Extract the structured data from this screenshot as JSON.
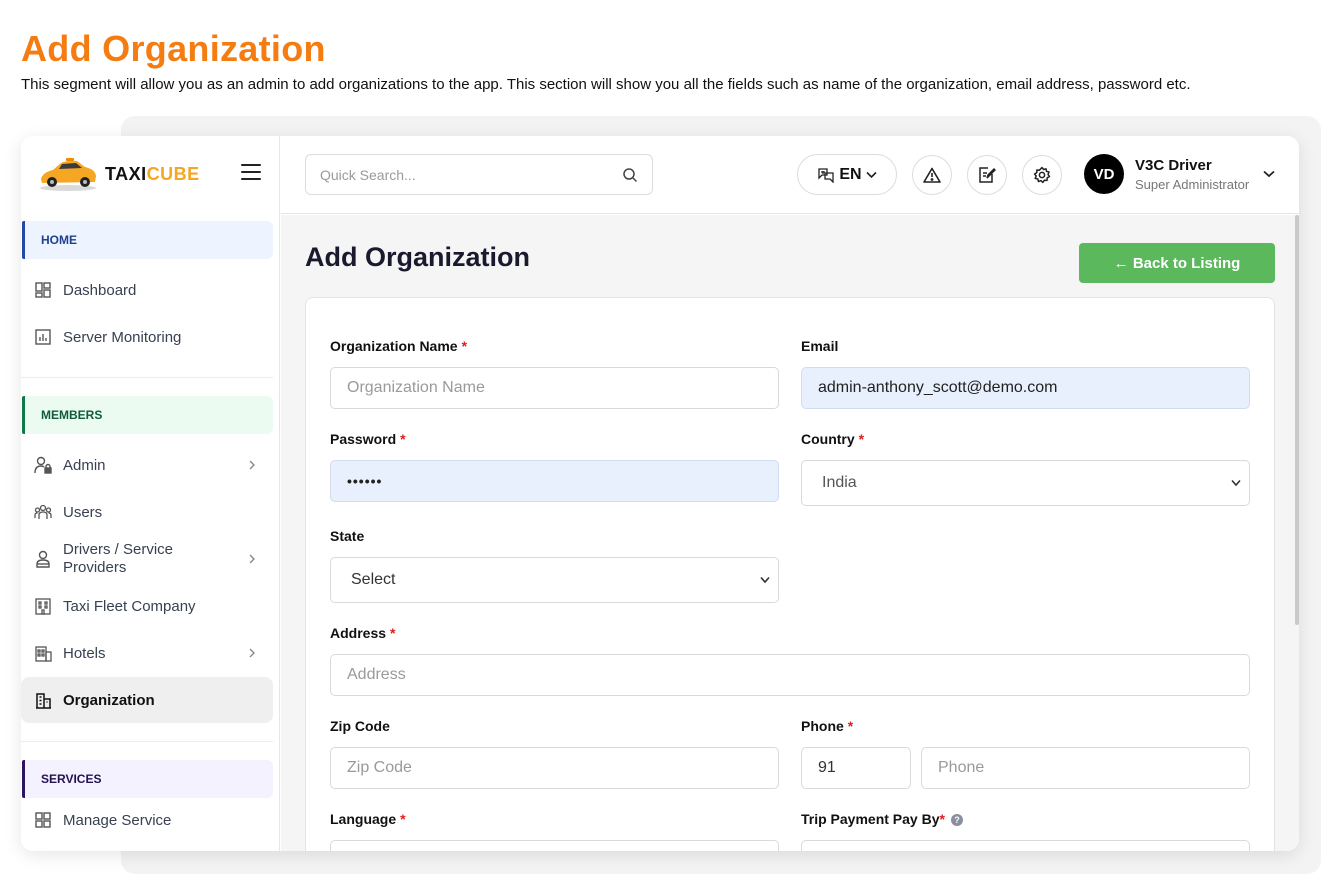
{
  "hero": {
    "title": "Add Organization",
    "description": "This segment will allow you as an admin to add organizations to the app. This section will show you all the fields such as name of the organization, email address, password etc."
  },
  "brand": {
    "name_a": "TAXI",
    "name_b": "CUBE",
    "accent": "#f5a623"
  },
  "sidebar": {
    "sections": {
      "home": "HOME",
      "members": "MEMBERS",
      "services": "SERVICES"
    },
    "items": [
      {
        "label": "Dashboard",
        "icon": "dashboard-icon"
      },
      {
        "label": "Server Monitoring",
        "icon": "monitor-chart-icon"
      },
      {
        "label": "Admin",
        "icon": "user-lock-icon",
        "has_submenu": true
      },
      {
        "label": "Users",
        "icon": "users-group-icon"
      },
      {
        "label": "Drivers / Service Providers",
        "icon": "driver-icon",
        "has_submenu": true
      },
      {
        "label": "Taxi Fleet Company",
        "icon": "building-icon"
      },
      {
        "label": "Hotels",
        "icon": "hotel-icon",
        "has_submenu": true
      },
      {
        "label": "Organization",
        "icon": "organization-icon",
        "active": true
      },
      {
        "label": "Manage Service",
        "icon": "grid-icon"
      }
    ]
  },
  "topbar": {
    "search_placeholder": "Quick Search...",
    "language": "EN",
    "user": {
      "initials": "VD",
      "name": "V3C Driver",
      "role": "Super Administrator"
    }
  },
  "page": {
    "title": "Add Organization",
    "back_label": "← Back to Listing",
    "back_color": "#5cb85c"
  },
  "form": {
    "org_name": {
      "label": "Organization Name",
      "placeholder": "Organization Name",
      "required": true
    },
    "email": {
      "label": "Email",
      "value": "admin-anthony_scott@demo.com"
    },
    "password": {
      "label": "Password",
      "value": "••••••",
      "required": true
    },
    "country": {
      "label": "Country",
      "value": "India",
      "required": true
    },
    "state": {
      "label": "State",
      "value": "Select"
    },
    "address": {
      "label": "Address",
      "placeholder": "Address",
      "required": true
    },
    "zip": {
      "label": "Zip Code",
      "placeholder": "Zip Code"
    },
    "phone": {
      "label": "Phone",
      "code": "91",
      "placeholder": "Phone",
      "required": true
    },
    "language": {
      "label": "Language",
      "required": true
    },
    "trip_payment": {
      "label": "Trip Payment Pay By",
      "required": true,
      "help": "?"
    }
  },
  "colors": {
    "accent_orange": "#f47c10",
    "required_red": "#e11d1d"
  }
}
